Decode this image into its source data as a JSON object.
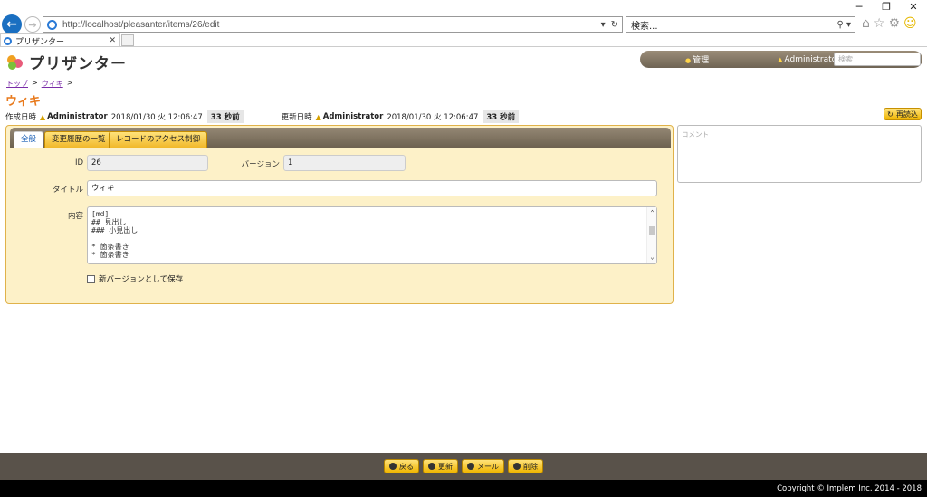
{
  "browser": {
    "url": "http://localhost/pleasanter/items/26/edit",
    "search_placeholder": "検索...",
    "tab_title": "プリザンター",
    "refresh_icon": "refresh-icon",
    "controls": {
      "minimize": "─",
      "restore": "❐",
      "close": "✕"
    }
  },
  "header": {
    "logo_text": "プリザンター",
    "admin_menu": "管理",
    "user_name": "Administrator",
    "search_placeholder": "検索"
  },
  "breadcrumb": [
    {
      "label": "トップ"
    },
    {
      "label": "ウィキ"
    }
  ],
  "breadcrumb_sep": ">",
  "page": {
    "title": "ウィキ",
    "created_label": "作成日時",
    "created_user": "Administrator",
    "created_time": "2018/01/30 火 12:06:47",
    "created_ago": "33 秒前",
    "updated_label": "更新日時",
    "updated_user": "Administrator",
    "updated_time": "2018/01/30 火 12:06:47",
    "updated_ago": "33 秒前",
    "reload_label": "再読込"
  },
  "tabs": [
    "全般",
    "変更履歴の一覧",
    "レコードのアクセス制御"
  ],
  "form": {
    "id_label": "ID",
    "id_value": "26",
    "version_label": "バージョン",
    "version_value": "1",
    "title_label": "タイトル",
    "title_value": "ウィキ",
    "content_label": "内容",
    "content_lines": [
      "[md]",
      "## 見出し",
      "### 小見出し",
      "",
      "* 箇条書き",
      "* 箇条書き"
    ],
    "new_version_label": "新バージョンとして保存"
  },
  "comment_placeholder": "コメント",
  "footer": {
    "buttons": [
      "戻る",
      "更新",
      "メール",
      "削除"
    ],
    "copyright": "Copyright © Implem Inc. 2014 - 2018"
  },
  "colors": {
    "accent": "#e87a1d",
    "panel": "#fdf1c8",
    "button": "#f0b500",
    "footer": "#59524a"
  }
}
